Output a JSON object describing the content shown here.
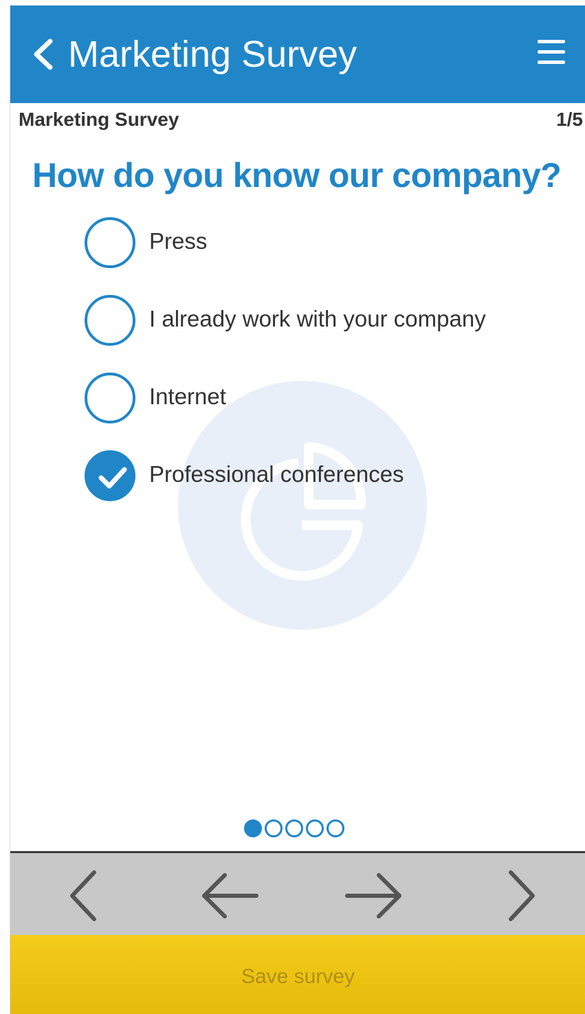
{
  "app_bar": {
    "title": "Marketing Survey",
    "back_icon": "chevron-left-icon",
    "menu_icon": "hamburger-menu-icon",
    "background": "#2086c8"
  },
  "sub_header": {
    "survey_name": "Marketing Survey",
    "page_counter": "1/5"
  },
  "question": {
    "text": "How do you know our company?",
    "options": [
      {
        "label": "Press",
        "checked": false
      },
      {
        "label": "I already work with your company",
        "checked": false
      },
      {
        "label": "Internet",
        "checked": false
      },
      {
        "label": "Professional conferences",
        "checked": true
      }
    ]
  },
  "pagination": {
    "total": 5,
    "current": 1
  },
  "nav": {
    "first_icon": "chevron-left-icon",
    "prev_icon": "arrow-left-icon",
    "next_icon": "arrow-right-icon",
    "last_icon": "chevron-right-icon"
  },
  "save": {
    "label": "Save survey",
    "background": "#f0c412"
  },
  "colors": {
    "accent": "#2086c8",
    "nav_background": "#c8c8c8"
  }
}
